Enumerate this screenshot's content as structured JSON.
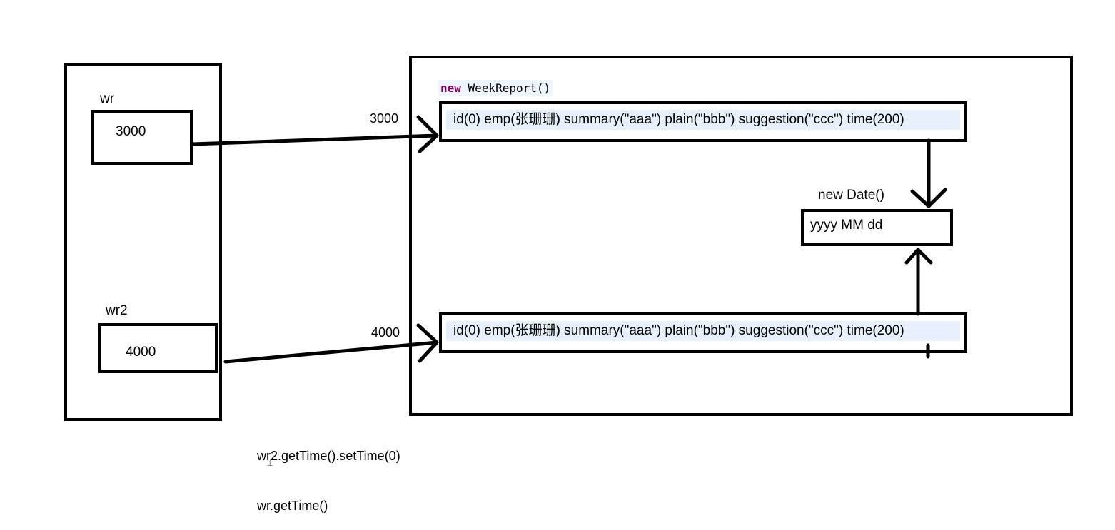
{
  "stack": {
    "var1": {
      "name": "wr",
      "value": "3000"
    },
    "var2": {
      "name": "wr2",
      "value": "4000"
    }
  },
  "heap": {
    "constructor": {
      "keyword": "new",
      "call": "WeekReport()"
    },
    "obj1": {
      "address": "3000",
      "fields": "id(0) emp(张珊珊)  summary(\"aaa\") plain(\"bbb\") suggestion(\"ccc\")  time(200)"
    },
    "obj2": {
      "address": "4000",
      "fields": "id(0) emp(张珊珊)  summary(\"aaa\") plain(\"bbb\") suggestion(\"ccc\")  time(200)"
    },
    "date": {
      "label": "new Date()",
      "value": "yyyy MM dd"
    }
  },
  "notes": {
    "line1": "wr2.getTime().setTime(0)",
    "line2": "wr.getTime()"
  }
}
